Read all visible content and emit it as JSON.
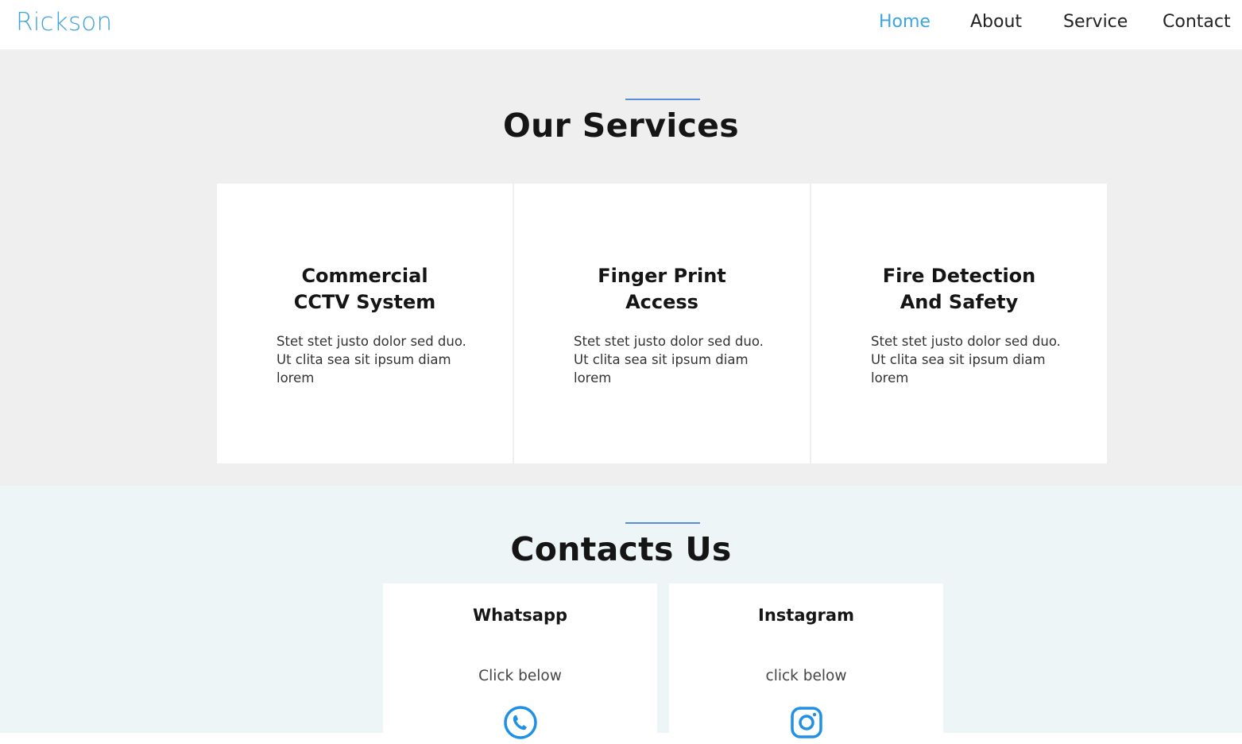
{
  "nav": {
    "brand": "Rickson",
    "links": [
      "Home",
      "About",
      "Service",
      "Contact"
    ],
    "active": "Home"
  },
  "services": {
    "title": "Our Services",
    "items": [
      {
        "title": "Commercial CCTV System",
        "text": "Stet stet justo dolor sed duo. Ut clita sea sit ipsum diam lorem"
      },
      {
        "title": "Finger Print Access",
        "text": "Stet stet justo dolor sed duo. Ut clita sea sit ipsum diam lorem"
      },
      {
        "title": "Fire Detection And Safety",
        "text": "Stet stet justo dolor sed duo. Ut clita sea sit ipsum diam lorem"
      }
    ]
  },
  "contacts": {
    "title": "Contacts Us",
    "items": [
      {
        "title": "Whatsapp",
        "subtitle": "Click below",
        "icon": "whatsapp-icon"
      },
      {
        "title": "Instagram",
        "subtitle": "click below",
        "icon": "instagram-icon"
      }
    ]
  },
  "colors": {
    "accent": "#3fa3dc",
    "rule": "#5a8fd8",
    "services_bg": "#efefef",
    "contacts_bg": "#eef5f7",
    "icon": "#1e90e6"
  }
}
